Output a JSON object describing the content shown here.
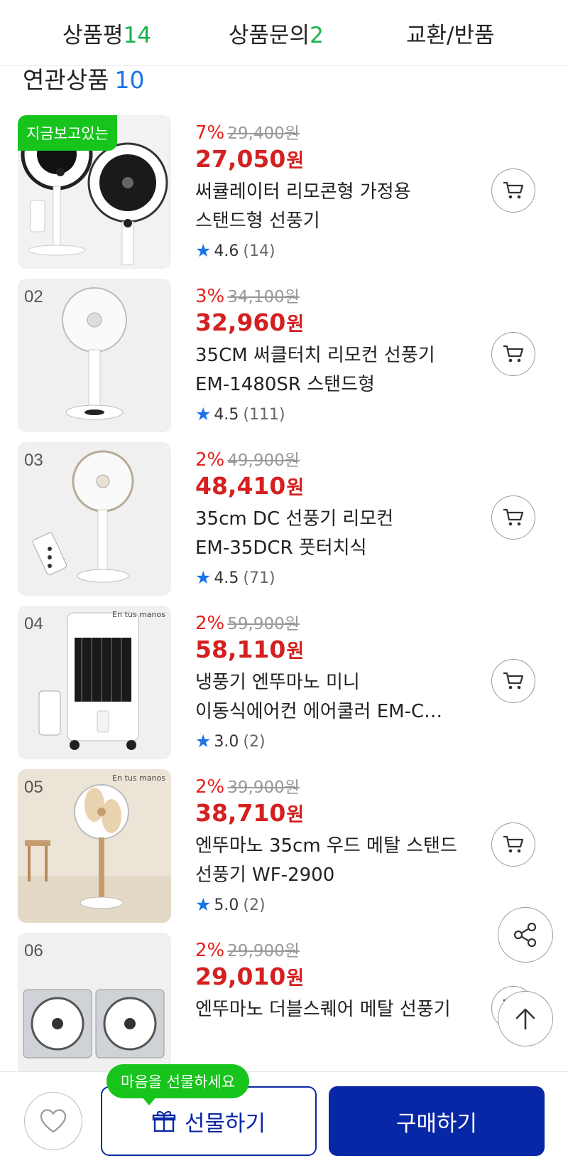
{
  "tabs": [
    {
      "label": "상품평",
      "count": "14"
    },
    {
      "label": "상품문의",
      "count": "2"
    },
    {
      "label": "교환/반품"
    }
  ],
  "section": {
    "title": "연관상품",
    "count": "10"
  },
  "current_badge": "지금보고있는",
  "won": "원",
  "products": [
    {
      "rank": "",
      "discount": "7%",
      "original_price": "29,400원",
      "price": "27,050",
      "name_line1": "써큘레이터 리모콘형 가정용",
      "name_line2": "스탠드형 선풍기",
      "rating": "4.6",
      "review_count": "(14)"
    },
    {
      "rank": "02",
      "discount": "3%",
      "original_price": "34,100원",
      "price": "32,960",
      "name_line1": "35CM 써클터치 리모컨 선풍기",
      "name_line2": "EM-1480SR 스탠드형",
      "rating": "4.5",
      "review_count": "(111)"
    },
    {
      "rank": "03",
      "discount": "2%",
      "original_price": "49,900원",
      "price": "48,410",
      "name_line1": "35cm DC 선풍기 리모컨",
      "name_line2": "EM-35DCR  풋터치식",
      "rating": "4.5",
      "review_count": "(71)"
    },
    {
      "rank": "04",
      "discount": "2%",
      "original_price": "59,900원",
      "price": "58,110",
      "name_line1": "냉풍기 엔뚜마노 미니",
      "name_line2": "이동식에어컨 에어쿨러 EM-C…",
      "rating": "3.0",
      "review_count": "(2)"
    },
    {
      "rank": "05",
      "discount": "2%",
      "original_price": "39,900원",
      "price": "38,710",
      "name_line1": "엔뚜마노 35cm 우드 메탈 스탠드",
      "name_line2": "선풍기 WF-2900",
      "rating": "5.0",
      "review_count": "(2)"
    },
    {
      "rank": "06",
      "discount": "2%",
      "original_price": "29,900원",
      "price": "29,010",
      "name_line1": "엔뚜마노  더블스퀘어 메탈 선풍기",
      "name_line2": "",
      "rating": "",
      "review_count": ""
    }
  ],
  "brand_mark": "En tus manos",
  "tooltip": "마음을 선물하세요",
  "gift_label": "선물하기",
  "buy_label": "구매하기",
  "colors": {
    "accent_blue": "#0827a6",
    "discount_red": "#d42020",
    "green": "#17c41c",
    "star_blue": "#1a73e8"
  }
}
